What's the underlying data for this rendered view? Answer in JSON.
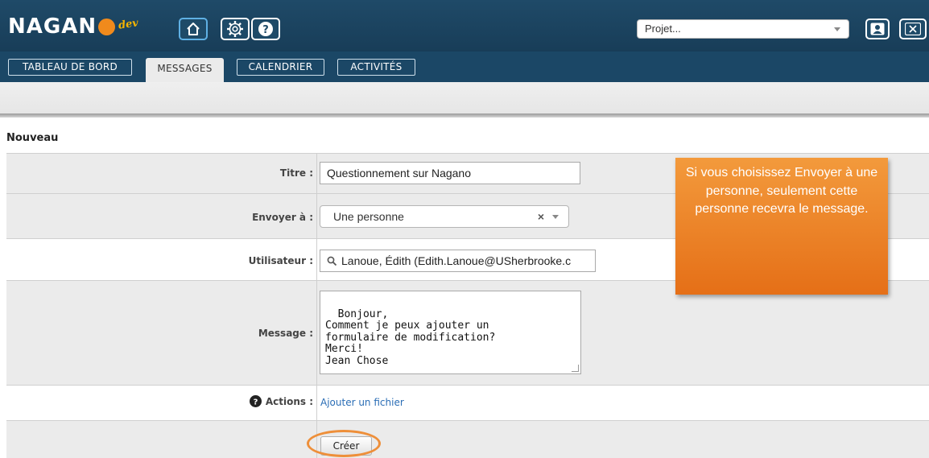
{
  "header": {
    "logo_text": "NAGANO",
    "logo_suffix": "dev",
    "project_select": {
      "value": "Projet..."
    }
  },
  "tabs": [
    {
      "label": "TABLEAU DE BORD",
      "active": false
    },
    {
      "label": "MESSAGES",
      "active": true
    },
    {
      "label": "CALENDRIER",
      "active": false
    },
    {
      "label": "ACTIVITÉS",
      "active": false
    }
  ],
  "form": {
    "section_title": "Nouveau",
    "titre": {
      "label": "Titre :",
      "value": "Questionnement sur Nagano"
    },
    "envoyer": {
      "label": "Envoyer à :",
      "value": "Une personne",
      "clear": "×"
    },
    "utilisateur": {
      "label": "Utilisateur :",
      "value": "Lanoue, Édith (Edith.Lanoue@USherbrooke.c"
    },
    "message": {
      "label": "Message :",
      "value": "Bonjour,\nComment je peux ajouter un\nformulaire de modification?\nMerci!\nJean Chose"
    },
    "actions": {
      "label": "Actions :",
      "link": "Ajouter un fichier"
    },
    "submit_label": "Créer"
  },
  "callout": {
    "text": "Si vous choisissez Envoyer à une personne, seulement cette personne recevra le message."
  },
  "colors": {
    "header_bg": "#1f4a68",
    "callout_bg": "#ef8a2c",
    "highlight": "#ee8f3a",
    "link": "#2a6db5"
  }
}
